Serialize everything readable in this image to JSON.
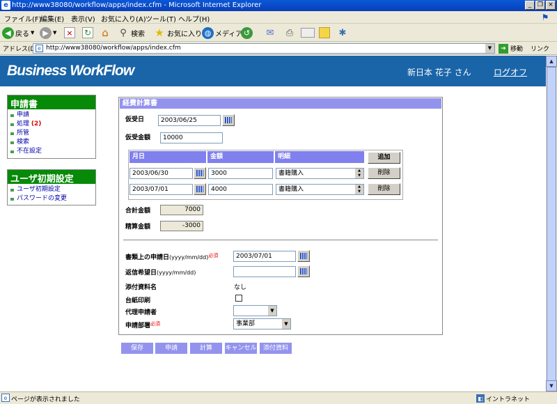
{
  "window": {
    "title": "http://www38080/workflow/apps/index.cfm - Microsoft Internet Explorer"
  },
  "menu": [
    "ファイル(F)",
    "編集(E)",
    "表示(V)",
    "お気に入り(A)",
    "ツール(T)",
    "ヘルプ(H)"
  ],
  "toolbar": {
    "back": "戻る",
    "search": "検索",
    "favorites": "お気に入り",
    "media": "メディア"
  },
  "address": {
    "label": "アドレス(D)",
    "url": "http://www38080/workflow/apps/index.cfm",
    "go": "移動",
    "links": "リンク"
  },
  "header": {
    "logo": "Business WorkFlow",
    "user": "新日本 花子 さん",
    "logout": "ログオフ"
  },
  "sidebar": {
    "section1": {
      "title": "申請書",
      "items": [
        "申請",
        "処理",
        "所管",
        "検索",
        "不在設定"
      ],
      "pending_badge": "(2)"
    },
    "section2": {
      "title": "ユーザ初期設定",
      "items": [
        "ユーザ初期設定",
        "パスワードの変更"
      ]
    }
  },
  "form": {
    "title": "経費計算書",
    "advance_date_label": "仮受日",
    "advance_date": "2003/06/25",
    "advance_amount_label": "仮受金額",
    "advance_amount": "10000",
    "table": {
      "headers": [
        "月日",
        "金額",
        "明細"
      ],
      "add_label": "追加",
      "delete_label": "削除",
      "rows": [
        {
          "date": "2003/06/30",
          "amount": "3000",
          "detail": "書籍購入"
        },
        {
          "date": "2003/07/01",
          "amount": "4000",
          "detail": "書籍購入"
        }
      ]
    },
    "total_label": "合計金額",
    "total": "7000",
    "settle_label": "精算金額",
    "settle": "-3000",
    "doc_date_label": "書類上の申請日",
    "doc_date_hint": "(yyyy/mm/dd)",
    "required_mark": "必須",
    "doc_date": "2003/07/01",
    "reply_date_label": "返信希望日",
    "reply_date_hint": "(yyyy/mm/dd)",
    "reply_date": "",
    "attach_label": "添付資料名",
    "attach_value": "なし",
    "print_label": "台紙印刷",
    "proxy_label": "代理申請者",
    "proxy_value": "",
    "dept_label": "申請部署",
    "dept_value": "事業部"
  },
  "actions": [
    "保存",
    "申請",
    "計算",
    "キャンセル",
    "添付資料"
  ],
  "status": {
    "text": "ページが表示されました",
    "zone": "イントラネット"
  }
}
